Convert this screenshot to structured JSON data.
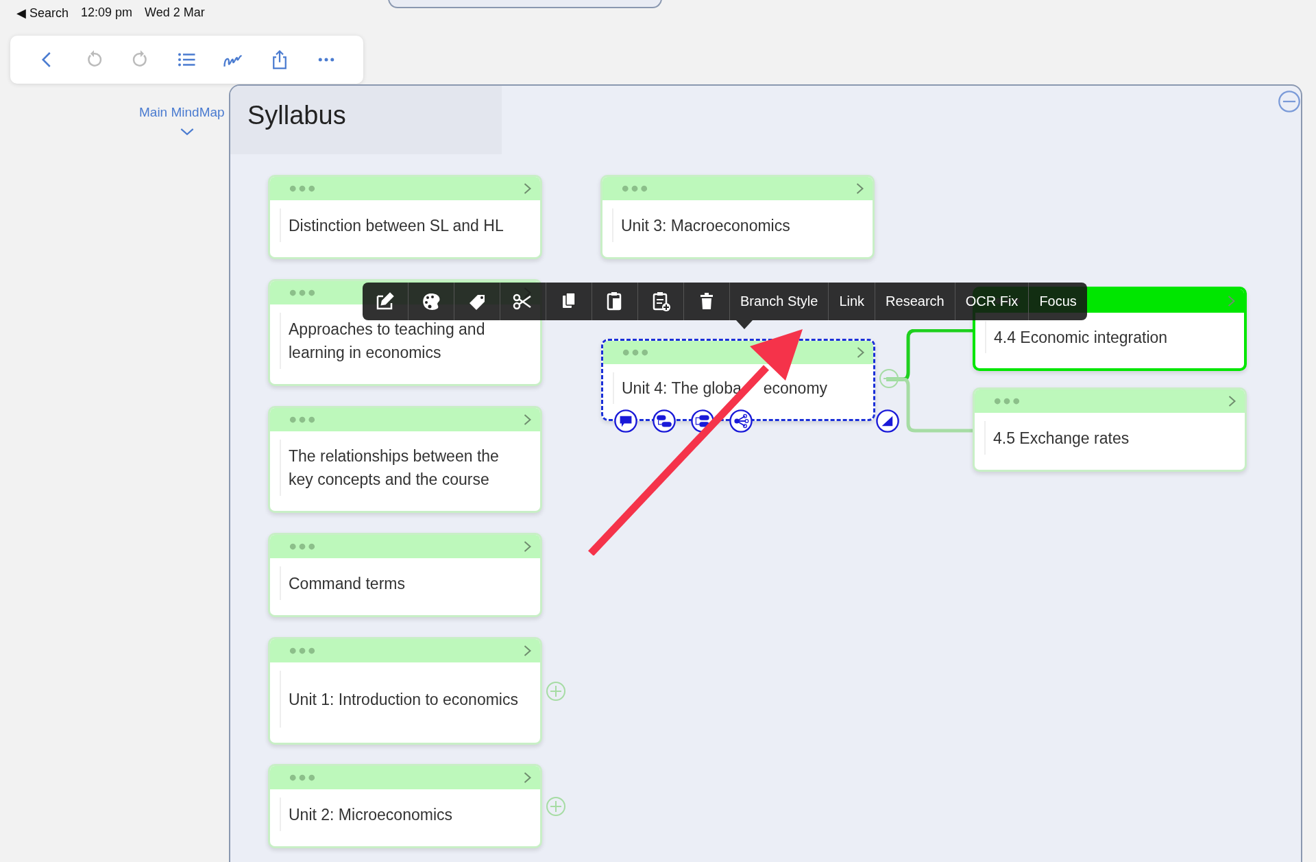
{
  "status_bar": {
    "back_label": "◀ Search",
    "time": "12:09 pm",
    "date": "Wed 2 Mar"
  },
  "toolbar": {
    "undo_enabled": false,
    "redo_enabled": false
  },
  "breadcrumb": {
    "label": "Main MindMap"
  },
  "map": {
    "title": "Syllabus",
    "left_nodes": [
      {
        "text": "Distinction between SL and HL",
        "color": "#bdf8bb",
        "selected": false
      },
      {
        "text": "Approaches to teaching and learning in economics",
        "color": "#bdf8bb",
        "selected": false
      },
      {
        "text": "The relationships between the key concepts and the course",
        "color": "#bdf8bb",
        "selected": false
      },
      {
        "text": "Command terms",
        "color": "#bdf8bb",
        "selected": false
      },
      {
        "text": "Unit 1: Introduction to economics",
        "color": "#bdf8bb",
        "selected": false,
        "expanded": false
      },
      {
        "text": "Unit 2: Microeconomics",
        "color": "#bdf8bb",
        "selected": false,
        "expanded": false
      }
    ],
    "center_nodes": [
      {
        "text": "Unit 3: Macroeconomics",
        "color": "#bdf8bb",
        "selected": false
      },
      {
        "text": "Unit 4: The globa",
        "text_continued": "economy",
        "color": "#bdf8bb",
        "selected": true,
        "expanded": true,
        "children": [
          {
            "text": "4.4 Economic integration",
            "color": "#00e600",
            "selected": false
          },
          {
            "text": "4.5 Exchange rates",
            "color": "#bdf8bb",
            "selected": false
          }
        ]
      }
    ]
  },
  "context_menu": {
    "items": [
      "Branch Style",
      "Link",
      "Research",
      "OCR Fix",
      "Focus"
    ]
  }
}
